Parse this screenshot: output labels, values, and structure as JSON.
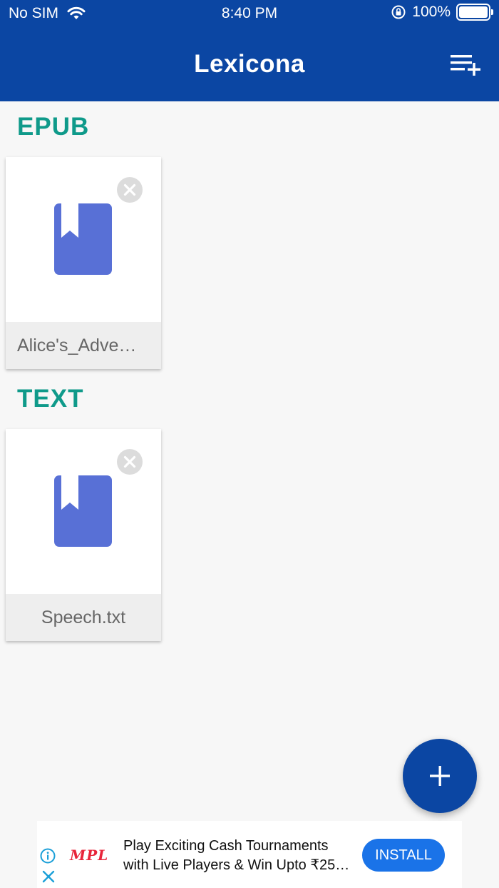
{
  "status_bar": {
    "carrier": "No SIM",
    "time": "8:40 PM",
    "battery": "100%",
    "icons": [
      "wifi-icon",
      "rotation-lock-icon",
      "battery-icon"
    ]
  },
  "app_bar": {
    "title": "Lexicona",
    "action_icon": "playlist-add-icon"
  },
  "sections": [
    {
      "title": "EPUB",
      "files": [
        {
          "name": "Alice's_Adve…",
          "icon": "book-icon"
        }
      ]
    },
    {
      "title": "TEXT",
      "files": [
        {
          "name": "Speech.txt",
          "icon": "book-icon"
        }
      ]
    }
  ],
  "fab": {
    "icon": "plus-icon"
  },
  "ad": {
    "brand": "MPL",
    "line1": "Play Exciting Cash Tournaments",
    "line2": "with Live Players & Win Upto ₹25…",
    "cta": "INSTALL"
  },
  "colors": {
    "primary": "#0b46a3",
    "section_title": "#0f9a8a",
    "book_icon": "#5870d6",
    "install_button": "#1a73e8",
    "brand_red": "#e8253a"
  }
}
